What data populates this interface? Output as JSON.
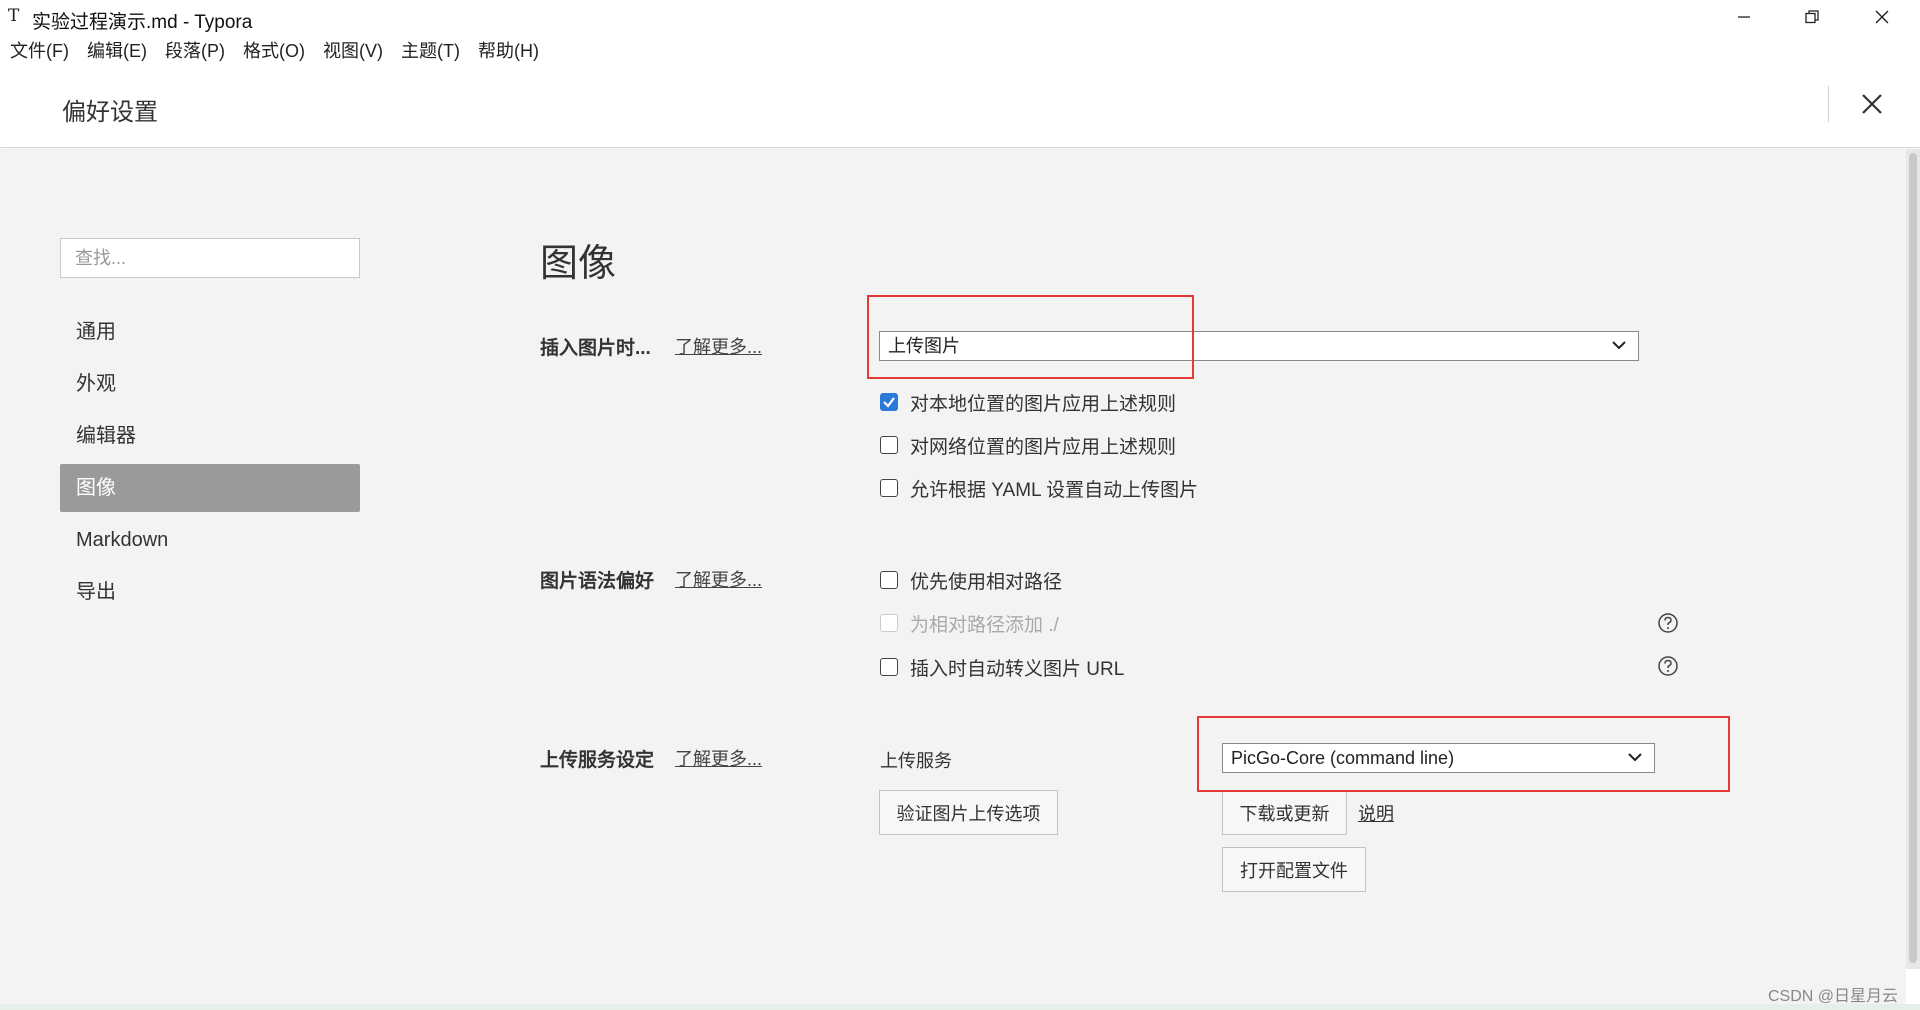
{
  "window": {
    "app_icon": "T",
    "title": "实验过程演示.md - Typora"
  },
  "menu": [
    "文件(F)",
    "编辑(E)",
    "段落(P)",
    "格式(O)",
    "视图(V)",
    "主题(T)",
    "帮助(H)"
  ],
  "preferences": {
    "title": "偏好设置"
  },
  "sidebar": {
    "search_placeholder": "查找...",
    "items": [
      {
        "label": "通用"
      },
      {
        "label": "外观"
      },
      {
        "label": "编辑器"
      },
      {
        "label": "图像",
        "active": true
      },
      {
        "label": "Markdown"
      },
      {
        "label": "导出"
      }
    ]
  },
  "main": {
    "heading": "图像",
    "insert": {
      "label": "插入图片时...",
      "learn_more": "了解更多...",
      "selected": "上传图片",
      "options": [
        {
          "label": "对本地位置的图片应用上述规则",
          "checked": true
        },
        {
          "label": "对网络位置的图片应用上述规则",
          "checked": false
        },
        {
          "label": "允许根据 YAML 设置自动上传图片",
          "checked": false
        }
      ]
    },
    "syntax": {
      "label": "图片语法偏好",
      "learn_more": "了解更多...",
      "options": [
        {
          "label": "优先使用相对路径",
          "checked": false
        },
        {
          "label": "为相对路径添加 ./",
          "checked": false,
          "disabled": true
        },
        {
          "label": "插入时自动转义图片 URL",
          "checked": false
        }
      ]
    },
    "upload": {
      "label": "上传服务设定",
      "learn_more": "了解更多...",
      "service_label": "上传服务",
      "service_selected": "PicGo-Core (command line)",
      "verify_button": "验证图片上传选项",
      "download_button": "下载或更新",
      "explain_link": "说明",
      "open_config_button": "打开配置文件"
    }
  },
  "colors": {
    "highlight_box": "#e53935",
    "checkbox_accent": "#2b79d8",
    "sidebar_active": "#9a9a9a",
    "content_bg": "#f3f3f3"
  },
  "watermark": "CSDN @日星月云"
}
